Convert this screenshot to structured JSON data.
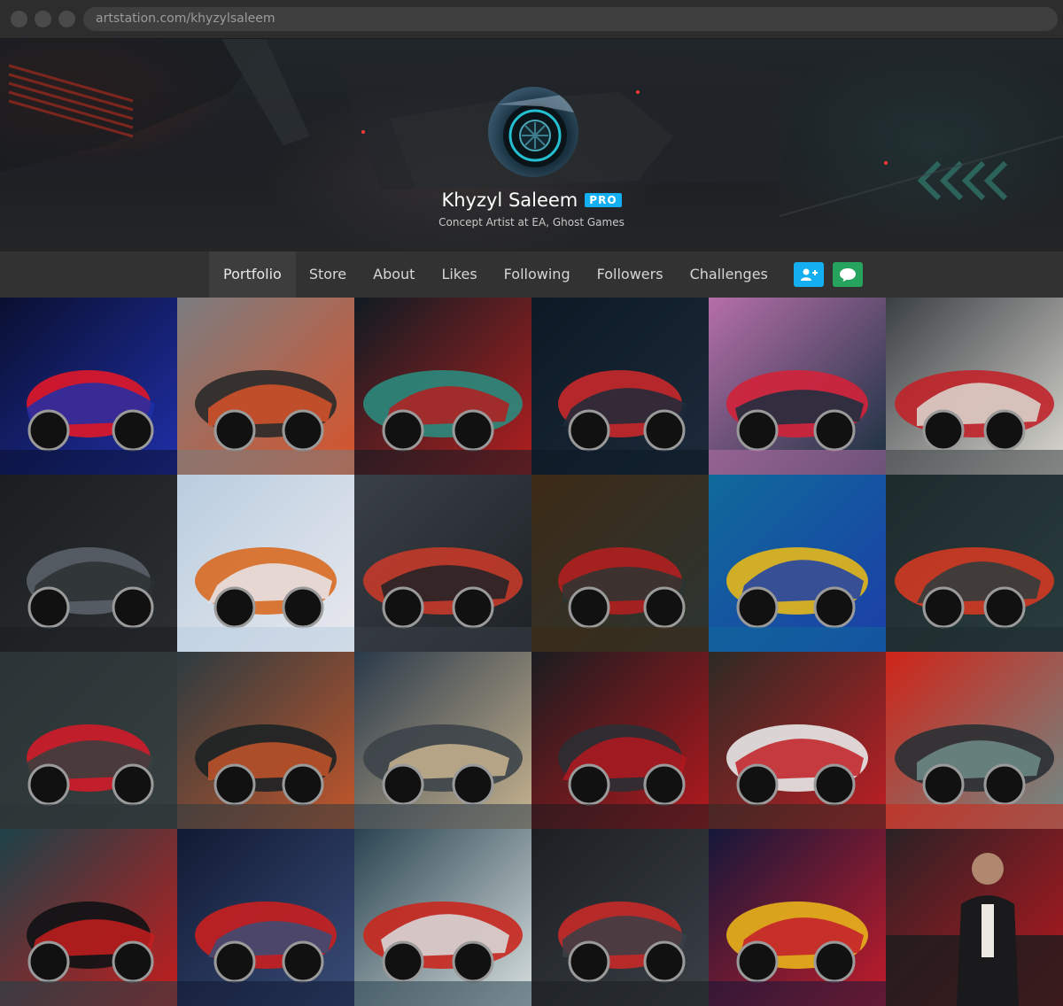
{
  "browser": {
    "url": "artstation.com/khyzylsaleem"
  },
  "profile": {
    "name": "Khyzyl Saleem",
    "badge": "PRO",
    "tagline": "Concept Artist at EA, Ghost Games",
    "avatar_icon": "wheel-avatar-image"
  },
  "nav": {
    "tabs": [
      "Portfolio",
      "Store",
      "About",
      "Likes",
      "Following",
      "Followers",
      "Challenges"
    ],
    "active_tab": "Portfolio",
    "follow_icon": "add-user-icon",
    "message_icon": "chat-bubble-icon"
  },
  "colors": {
    "accent_blue": "#13aff0",
    "accent_green": "#26a35c",
    "nav_bg": "#323232"
  },
  "portfolio": {
    "rows": 4,
    "columns": 6,
    "tiles": [
      {
        "palette": [
          "#0a1030",
          "#1f2fa8",
          "#e0182a"
        ],
        "shape": "car"
      },
      {
        "palette": [
          "#7a7d80",
          "#d9532a",
          "#2a2a2a"
        ],
        "shape": "car"
      },
      {
        "palette": [
          "#0f1c22",
          "#b41f1f",
          "#2b8a7d"
        ],
        "shape": "car"
      },
      {
        "palette": [
          "#0b1a25",
          "#1d2a3a",
          "#c7282a"
        ],
        "shape": "car"
      },
      {
        "palette": [
          "#b56fa8",
          "#17303f",
          "#d2223a"
        ],
        "shape": "car"
      },
      {
        "palette": [
          "#3a3f44",
          "#dcdad2",
          "#c0232a"
        ],
        "shape": "car"
      },
      {
        "palette": [
          "#1b1e20",
          "#2c3033",
          "#5a6168"
        ],
        "shape": "car"
      },
      {
        "palette": [
          "#b9cde0",
          "#e9e9ee",
          "#d86a22"
        ],
        "shape": "car"
      },
      {
        "palette": [
          "#3a4048",
          "#1e2226",
          "#c43a2a"
        ],
        "shape": "car"
      },
      {
        "palette": [
          "#3d2a16",
          "#2c3532",
          "#b02020"
        ],
        "shape": "car"
      },
      {
        "palette": [
          "#0f6a9a",
          "#1c3ea8",
          "#e6b81a"
        ],
        "shape": "car"
      },
      {
        "palette": [
          "#1d2b2d",
          "#2a3c3e",
          "#d03a22"
        ],
        "shape": "car"
      },
      {
        "palette": [
          "#2b3336",
          "#36403f",
          "#d11c2a"
        ],
        "shape": "car"
      },
      {
        "palette": [
          "#2c3b40",
          "#c4562a",
          "#1d2225"
        ],
        "shape": "car"
      },
      {
        "palette": [
          "#2a3a4a",
          "#c9b590",
          "#3d4449"
        ],
        "shape": "car"
      },
      {
        "palette": [
          "#1a1c1f",
          "#b3191e",
          "#2b2f33"
        ],
        "shape": "car"
      },
      {
        "palette": [
          "#2d2a24",
          "#c01e24",
          "#e8e8e8"
        ],
        "shape": "car"
      },
      {
        "palette": [
          "#d02418",
          "#6e8c88",
          "#2a3034"
        ],
        "shape": "car"
      },
      {
        "palette": [
          "#1c4248",
          "#c51d1d",
          "#0f1214"
        ],
        "shape": "car"
      },
      {
        "palette": [
          "#101a33",
          "#3a4c78",
          "#c82020"
        ],
        "shape": "car"
      },
      {
        "palette": [
          "#2a4450",
          "#d8e0e0",
          "#c9281f"
        ],
        "shape": "car"
      },
      {
        "palette": [
          "#1c1f22",
          "#3a4047",
          "#c52a28"
        ],
        "shape": "car"
      },
      {
        "palette": [
          "#14183a",
          "#c31c2a",
          "#e8b21c"
        ],
        "shape": "car"
      },
      {
        "palette": [
          "#2a2225",
          "#b7181f",
          "#1b1b1d"
        ],
        "shape": "person"
      }
    ]
  }
}
